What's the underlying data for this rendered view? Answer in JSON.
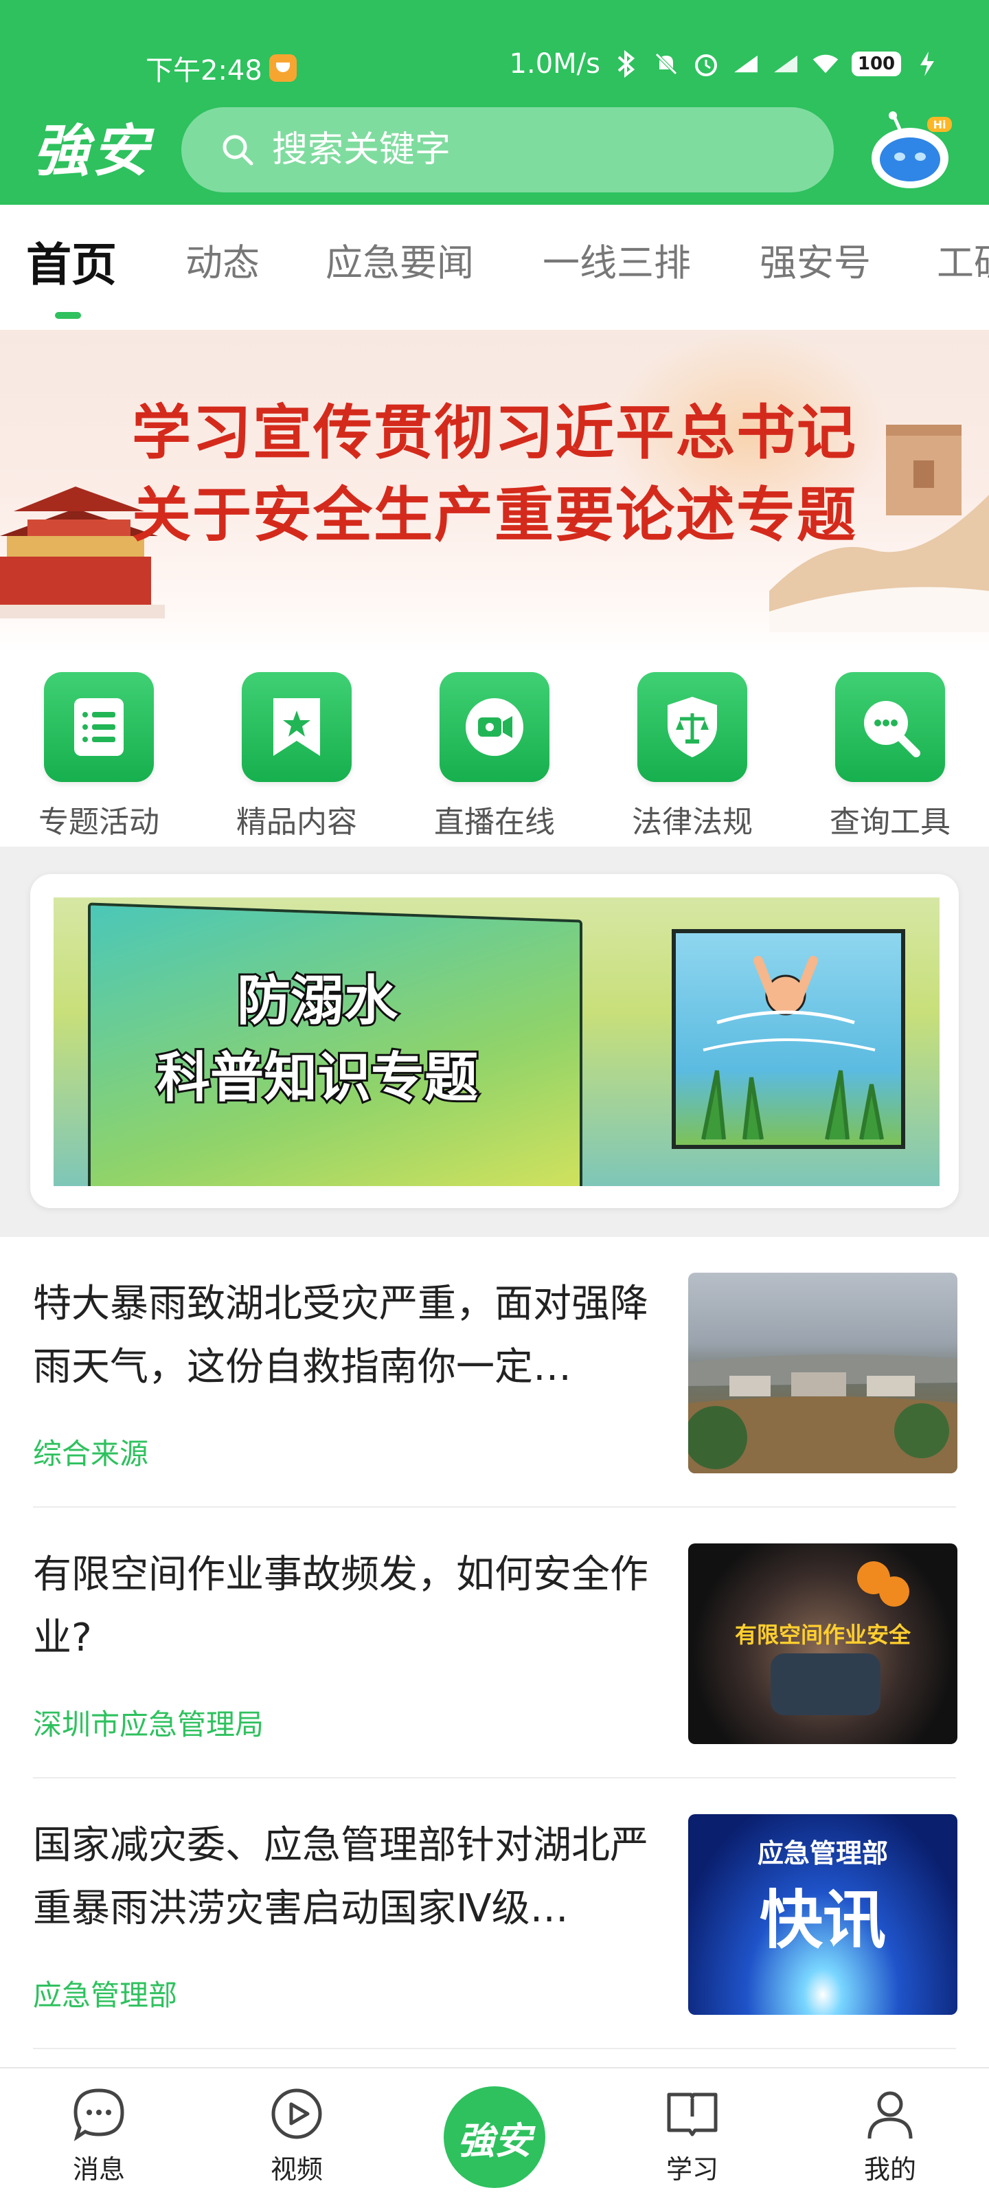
{
  "status_bar": {
    "time": "下午2:48",
    "network_speed": "1.0M/s",
    "battery": "100"
  },
  "header": {
    "logo_text": "強安",
    "search_placeholder": "搜索关键字",
    "assistant_badge": "Hi"
  },
  "tabs": [
    {
      "label": "首页",
      "active": true
    },
    {
      "label": "动态",
      "active": false
    },
    {
      "label": "应急要闻",
      "active": false
    },
    {
      "label": "一线三排",
      "active": false
    },
    {
      "label": "强安号",
      "active": false
    },
    {
      "label": "工矿",
      "active": false
    }
  ],
  "hero": {
    "line1": "学习宣传贯彻习近平总书记",
    "line2": "关于安全生产重要论述专题"
  },
  "quick_actions": [
    {
      "label": "专题活动",
      "icon": "list-document-icon"
    },
    {
      "label": "精品内容",
      "icon": "bookmark-star-icon"
    },
    {
      "label": "直播在线",
      "icon": "video-camera-icon"
    },
    {
      "label": "法律法规",
      "icon": "shield-scale-icon"
    },
    {
      "label": "查询工具",
      "icon": "search-dots-icon"
    }
  ],
  "promo": {
    "line1": "防溺水",
    "line2": "科普知识专题"
  },
  "news": [
    {
      "title": "特大暴雨致湖北受灾严重，面对强降雨天气，这份自救指南你一定…",
      "source": "综合来源"
    },
    {
      "title": "有限空间作业事故频发，如何安全作业?",
      "source": "深圳市应急管理局",
      "thumb_text": "有限空间作业安全"
    },
    {
      "title": "国家减灾委、应急管理部针对湖北严重暴雨洪涝灾害启动国家Ⅳ级…",
      "source": "应急管理部",
      "thumb_text1": "应急管理部",
      "thumb_text2": "快讯"
    }
  ],
  "bottom_nav": {
    "messages": "消息",
    "video": "视频",
    "center": "強安",
    "study": "学习",
    "mine": "我的"
  },
  "colors": {
    "brand_green": "#2ec15e",
    "hero_red": "#d42a1c"
  }
}
